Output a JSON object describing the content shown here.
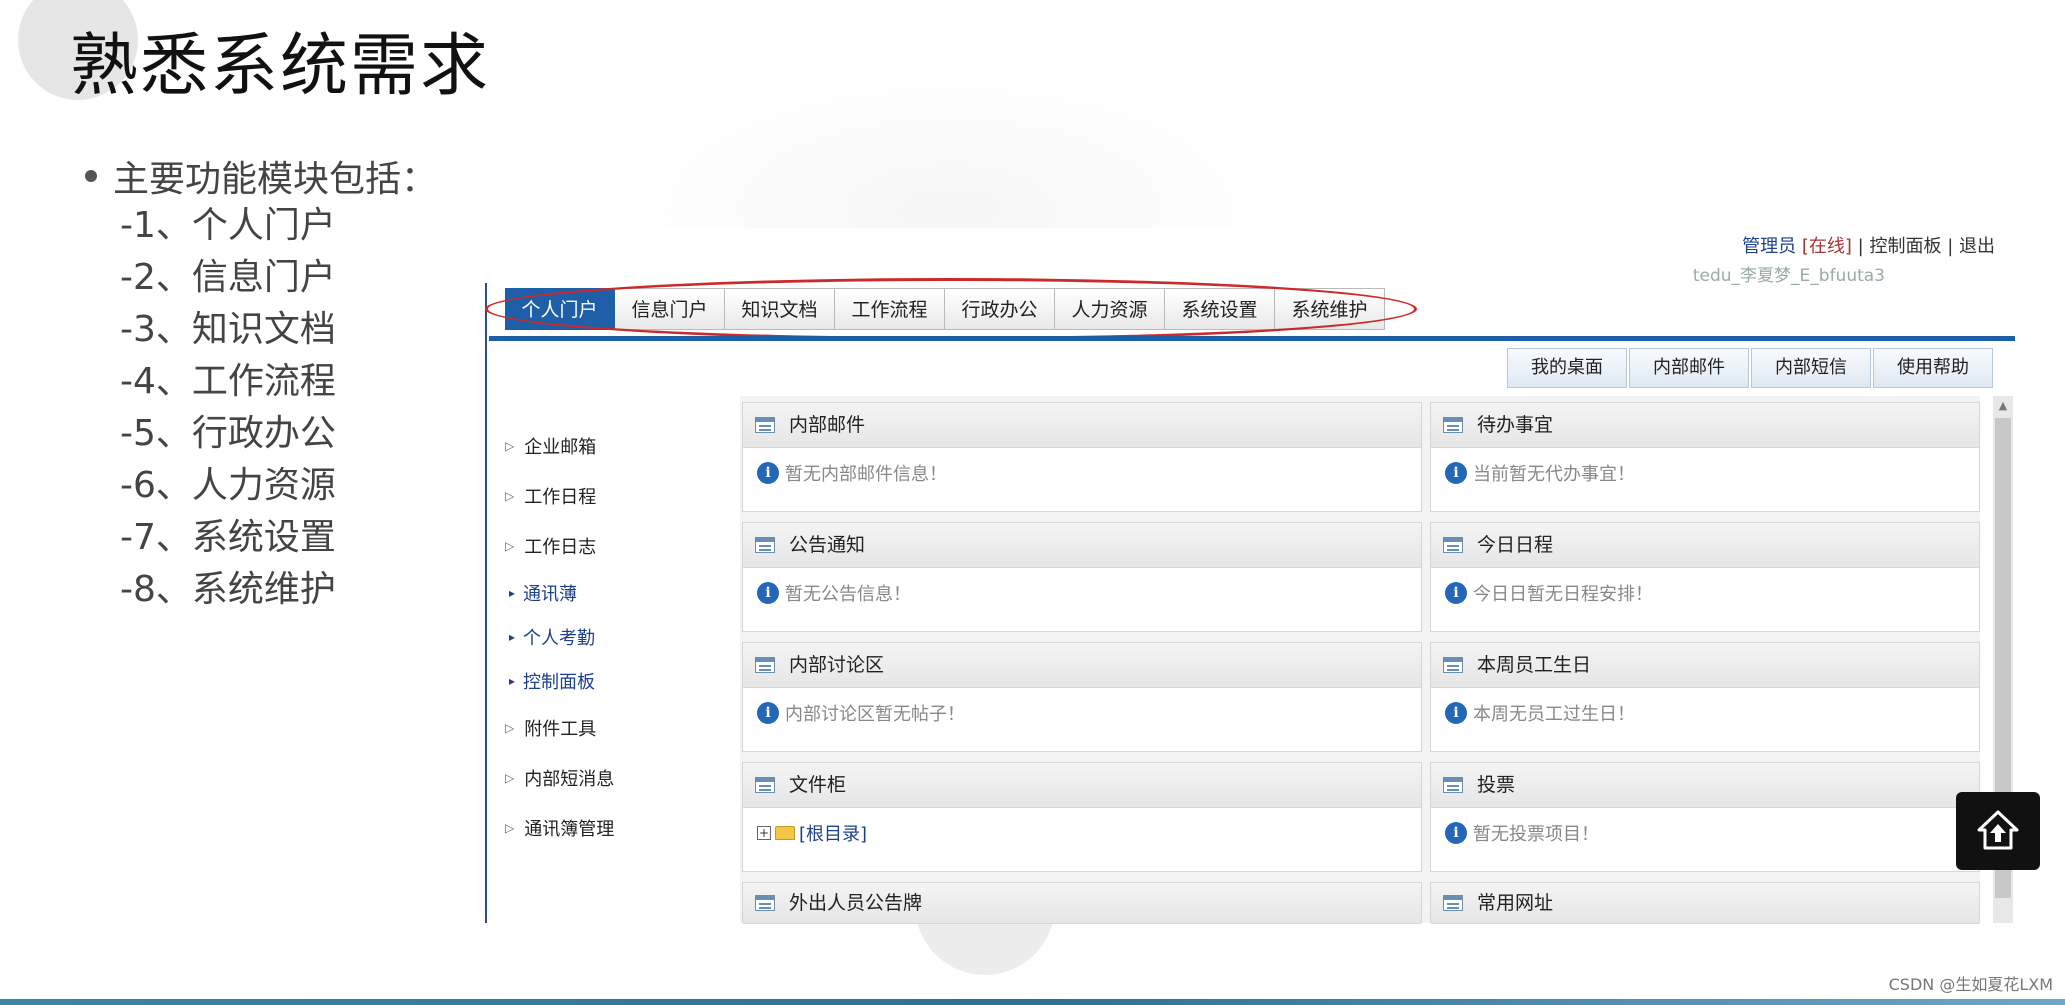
{
  "slide": {
    "title": "熟悉系统需求",
    "bullet": "主要功能模块包括：",
    "modules": [
      "-1、个人门户",
      "-2、信息门户",
      "-3、知识文档",
      "-4、工作流程",
      "-5、行政办公",
      "-6、人力资源",
      "-7、系统设置",
      "-8、系统维护"
    ]
  },
  "app": {
    "user_bar": {
      "role": "管理员",
      "status": "[在线]",
      "sep": "|",
      "control_panel": "控制面板",
      "logout": "退出",
      "user_id": "tedu_李夏梦_E_bfuuta3"
    },
    "nav_tabs": [
      "个人门户",
      "信息门户",
      "知识文档",
      "工作流程",
      "行政办公",
      "人力资源",
      "系统设置",
      "系统维护"
    ],
    "active_tab": "个人门户",
    "quick_buttons": [
      "我的桌面",
      "内部邮件",
      "内部短信",
      "使用帮助"
    ],
    "sidebar": {
      "items": [
        "企业邮箱",
        "工作日程",
        "工作日志"
      ],
      "subitems": [
        "通讯薄",
        "个人考勤",
        "控制面板"
      ],
      "items2": [
        "附件工具",
        "内部短消息",
        "通讯簿管理"
      ]
    },
    "panels": {
      "mail": {
        "title": "内部邮件",
        "body": "暂无内部邮件信息！"
      },
      "todo": {
        "title": "待办事宜",
        "body": "当前暂无代办事宜！"
      },
      "notice": {
        "title": "公告通知",
        "body": "暂无公告信息！"
      },
      "schedule": {
        "title": "今日日程",
        "body": "今日日暂无日程安排！"
      },
      "forum": {
        "title": "内部讨论区",
        "body": "内部讨论区暂无帖子！"
      },
      "birthday": {
        "title": "本周员工生日",
        "body": "本周无员工过生日！"
      },
      "files": {
        "title": "文件柜",
        "body": "[根目录]"
      },
      "vote": {
        "title": "投票",
        "body": "暂无投票项目！"
      },
      "outside": {
        "title": "外出人员公告牌"
      },
      "links": {
        "title": "常用网址"
      }
    }
  },
  "icons": {
    "home": "home-upload-icon",
    "info": "info-icon",
    "panel": "window-icon"
  },
  "watermark": "CSDN @生如夏花LXM"
}
